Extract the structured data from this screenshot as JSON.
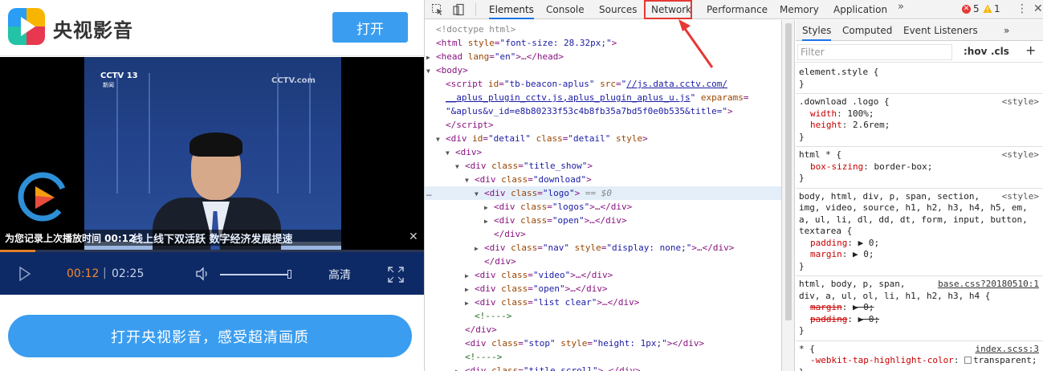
{
  "mobile": {
    "brand": "央视影音",
    "open_button": "打开",
    "video": {
      "channel": "CCTV 13",
      "channel_sub": "新闻",
      "watermark": "CCTV.com",
      "resume_notice": "为您记录上次播放时间 00:12",
      "headline": "线上线下双活跃 数字经济发展提速",
      "current_time": "00:12",
      "separator": "|",
      "total_time": "02:25",
      "quality": "高清",
      "progress_fraction": 0.083,
      "volume_fraction": 1.0
    },
    "big_button": "打开央视影音，感受超清画质"
  },
  "devtools": {
    "tabs": [
      "Elements",
      "Console",
      "Sources",
      "Network",
      "Performance",
      "Memory",
      "Application"
    ],
    "more": "»",
    "error_count": "5",
    "warning_count": "1",
    "elements_lines": [
      {
        "ind": 0,
        "tri": "",
        "html": "<span class='gray'>&lt;!doctype html&gt;</span>"
      },
      {
        "ind": 0,
        "tri": "",
        "html": "<span class='tag'>&lt;html</span> <span class='attr'>style</span>=<span class='val'>\"font-size: 28.32px;\"</span><span class='tag'>&gt;</span>"
      },
      {
        "ind": 0,
        "tri": "▶",
        "html": "<span class='tag'>&lt;head</span> <span class='attr'>lang</span>=<span class='val'>\"en\"</span><span class='tag'>&gt;</span>…<span class='tag'>&lt;/head&gt;</span>"
      },
      {
        "ind": 0,
        "tri": "▼",
        "html": "<span class='tag'>&lt;body&gt;</span>"
      },
      {
        "ind": 1,
        "tri": "",
        "html": "<span class='tag'>&lt;script</span> <span class='attr'>id</span>=<span class='val'>\"tb-beacon-aplus\"</span> <span class='attr'>src</span>=<span class='val'>\"<span class='link'>//js.data.cctv.com/</span></span>"
      },
      {
        "ind": 1,
        "tri": "",
        "html": "<span class='val'><span class='link'>__aplus_plugin_cctv.js,aplus_plugin_aplus_u.js</span>\"</span> <span class='attr'>exparams</span>="
      },
      {
        "ind": 1,
        "tri": "",
        "html": "<span class='val'>\"&amp;aplus&amp;v_id=e8b80233f53c4b8fb35a7bd5f0e0b535&amp;title=\"</span><span class='tag'>&gt;</span>"
      },
      {
        "ind": 1,
        "tri": "",
        "html": "<span class='tag'>&lt;/script&gt;</span>"
      },
      {
        "ind": 1,
        "tri": "▼",
        "html": "<span class='tag'>&lt;div</span> <span class='attr'>id</span>=<span class='val'>\"detail\"</span> <span class='attr'>class</span>=<span class='val'>\"detail\"</span> <span class='attr'>style</span><span class='tag'>&gt;</span>"
      },
      {
        "ind": 2,
        "tri": "▼",
        "html": "<span class='tag'>&lt;div&gt;</span>"
      },
      {
        "ind": 3,
        "tri": "▼",
        "html": "<span class='tag'>&lt;div</span> <span class='attr'>class</span>=<span class='val'>\"title_show\"</span><span class='tag'>&gt;</span>"
      },
      {
        "ind": 4,
        "tri": "▼",
        "html": "<span class='tag'>&lt;div</span> <span class='attr'>class</span>=<span class='val'>\"download\"</span><span class='tag'>&gt;</span>"
      },
      {
        "ind": 5,
        "tri": "▼",
        "sel": true,
        "html": "<span class='tag'>&lt;div</span> <span class='attr'>class</span>=<span class='val'>\"logo\"</span><span class='tag'>&gt;</span> <span class='gray'>== <i>$0</i></span>"
      },
      {
        "ind": 6,
        "tri": "▶",
        "html": "<span class='tag'>&lt;div</span> <span class='attr'>class</span>=<span class='val'>\"logos\"</span><span class='tag'>&gt;</span>…<span class='tag'>&lt;/div&gt;</span>"
      },
      {
        "ind": 6,
        "tri": "▶",
        "html": "<span class='tag'>&lt;div</span> <span class='attr'>class</span>=<span class='val'>\"open\"</span><span class='tag'>&gt;</span>…<span class='tag'>&lt;/div&gt;</span>"
      },
      {
        "ind": 6,
        "tri": "",
        "html": "<span class='tag'>&lt;/div&gt;</span>"
      },
      {
        "ind": 5,
        "tri": "▶",
        "html": "<span class='tag'>&lt;div</span> <span class='attr'>class</span>=<span class='val'>\"nav\"</span> <span class='attr'>style</span>=<span class='val'>\"display: none;\"</span><span class='tag'>&gt;</span>…<span class='tag'>&lt;/div&gt;</span>"
      },
      {
        "ind": 5,
        "tri": "",
        "html": "<span class='tag'>&lt;/div&gt;</span>"
      },
      {
        "ind": 4,
        "tri": "▶",
        "html": "<span class='tag'>&lt;div</span> <span class='attr'>class</span>=<span class='val'>\"video\"</span><span class='tag'>&gt;</span>…<span class='tag'>&lt;/div&gt;</span>"
      },
      {
        "ind": 4,
        "tri": "▶",
        "html": "<span class='tag'>&lt;div</span> <span class='attr'>class</span>=<span class='val'>\"open\"</span><span class='tag'>&gt;</span>…<span class='tag'>&lt;/div&gt;</span>"
      },
      {
        "ind": 4,
        "tri": "▶",
        "html": "<span class='tag'>&lt;div</span> <span class='attr'>class</span>=<span class='val'>\"list clear\"</span><span class='tag'>&gt;</span>…<span class='tag'>&lt;/div&gt;</span>"
      },
      {
        "ind": 4,
        "tri": "",
        "html": "<span class='cmt'>&lt;!----&gt;</span>"
      },
      {
        "ind": 3,
        "tri": "",
        "html": "<span class='tag'>&lt;/div&gt;</span>"
      },
      {
        "ind": 3,
        "tri": "",
        "html": "<span class='tag'>&lt;div</span> <span class='attr'>class</span>=<span class='val'>\"stop\"</span> <span class='attr'>style</span>=<span class='val'>\"height: 1px;\"</span><span class='tag'>&gt;&lt;/div&gt;</span>"
      },
      {
        "ind": 3,
        "tri": "",
        "html": "<span class='cmt'>&lt;!----&gt;</span>"
      },
      {
        "ind": 3,
        "tri": "▶",
        "html": "<span class='tag'>&lt;div</span> <span class='attr'>class</span>=<span class='val'>\"title_scroll\"</span><span class='tag'>&gt;</span>…<span class='tag'>&lt;/div&gt;</span>"
      }
    ],
    "styles_tabs": [
      "Styles",
      "Computed",
      "Event Listeners"
    ],
    "filter_placeholder": "Filter",
    "hov": ":hov",
    "cls": ".cls",
    "plus": "+",
    "rules": [
      {
        "lines": [
          "element.style {",
          "}"
        ],
        "source": ""
      },
      {
        "lines": [
          ".download .logo {",
          "  width: 100%;",
          "  height: 2.6rem;",
          "}"
        ],
        "source": "<style>"
      },
      {
        "lines": [
          "html * {",
          "  box-sizing: border-box;",
          "}"
        ],
        "source": "<style>"
      },
      {
        "lines": [
          "body, html, div, p, span, section,",
          "img, video, source, h1, h2, h3, h4, h5, em,",
          "a, ul, li, dl, dd, dt, form, input, button,",
          "textarea {",
          "  padding: ▶ 0;",
          "  margin: ▶ 0;",
          "}"
        ],
        "source": "<style>"
      },
      {
        "lines": [
          "html, body, p, span,",
          "div, a, ul, ol, li, h1, h2, h3, h4 {",
          "  margin: ▶ 0;",
          "  padding: ▶ 0;",
          "}"
        ],
        "source": "base.css?20180510:1",
        "struck": true
      },
      {
        "lines": [
          "* {",
          "  -webkit-tap-highlight-color: transparent;",
          "}"
        ],
        "source": "index.scss:3"
      }
    ]
  }
}
